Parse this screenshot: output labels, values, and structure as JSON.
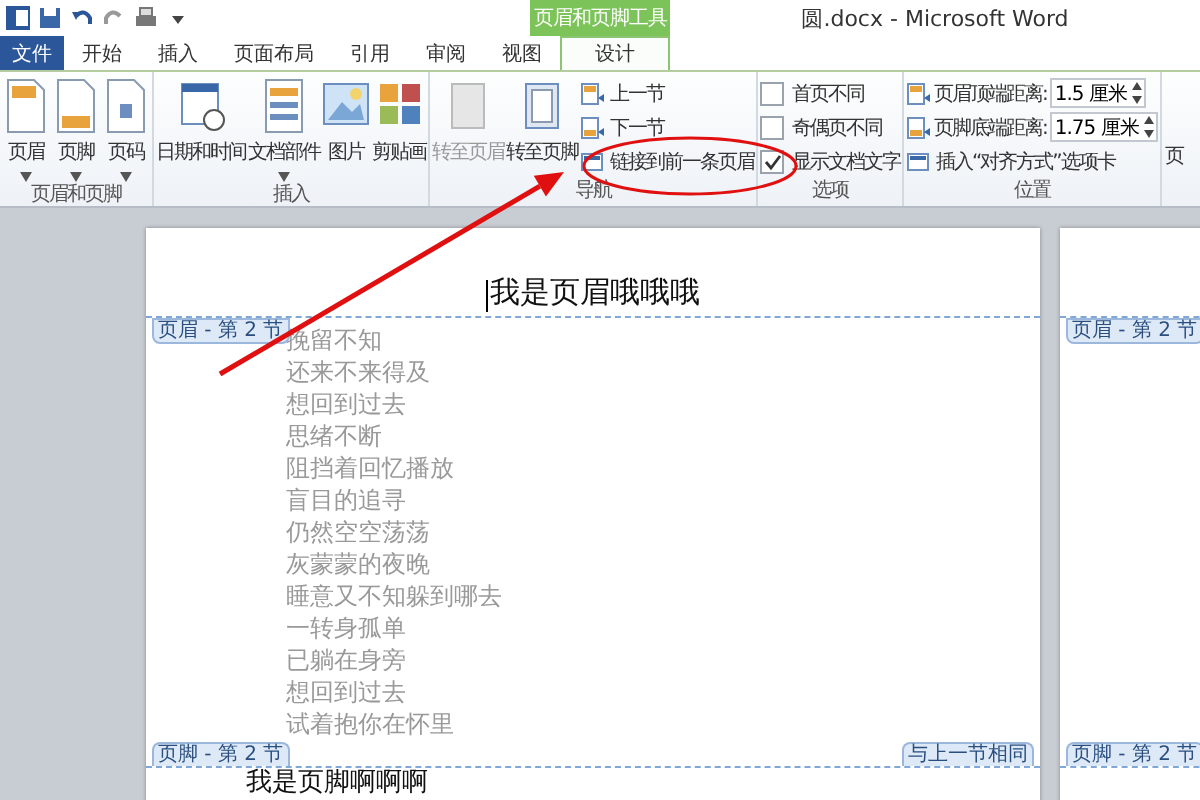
{
  "title_bar": {
    "contextual_tab": "页眉和页脚工具",
    "title": "圆.docx - Microsoft Word"
  },
  "tabs": [
    {
      "label": "文件",
      "kind": "file",
      "selected": false
    },
    {
      "label": "开始",
      "kind": "normal",
      "selected": false
    },
    {
      "label": "插入",
      "kind": "normal",
      "selected": false
    },
    {
      "label": "页面布局",
      "kind": "normal",
      "selected": false
    },
    {
      "label": "引用",
      "kind": "normal",
      "selected": false
    },
    {
      "label": "审阅",
      "kind": "normal",
      "selected": false
    },
    {
      "label": "视图",
      "kind": "normal",
      "selected": false
    },
    {
      "label": "设计",
      "kind": "contextual",
      "selected": true
    }
  ],
  "ribbon_groups": [
    {
      "name": "页眉和页脚",
      "items": [
        {
          "kind": "large",
          "label": "页眉",
          "dropdown": true,
          "disabled": false
        },
        {
          "kind": "large",
          "label": "页脚",
          "dropdown": true,
          "disabled": false
        },
        {
          "kind": "large",
          "label": "页码",
          "dropdown": true,
          "disabled": false
        }
      ]
    },
    {
      "name": "插入",
      "items": [
        {
          "kind": "large",
          "label": "日期和时间",
          "dropdown": false,
          "disabled": false
        },
        {
          "kind": "large",
          "label": "文档部件",
          "dropdown": true,
          "disabled": false
        },
        {
          "kind": "large",
          "label": "图片",
          "dropdown": false,
          "disabled": false
        },
        {
          "kind": "large",
          "label": "剪贴画",
          "dropdown": false,
          "disabled": false
        }
      ]
    },
    {
      "name": "导航",
      "items": [
        {
          "kind": "large",
          "label": "转至页眉",
          "dropdown": false,
          "disabled": true
        },
        {
          "kind": "large",
          "label": "转至页脚",
          "dropdown": false,
          "disabled": false
        },
        {
          "kind": "small",
          "label": "上一节"
        },
        {
          "kind": "small",
          "label": "下一节"
        },
        {
          "kind": "small",
          "label": "链接到前一条页眉"
        }
      ]
    },
    {
      "name": "选项",
      "items": [
        {
          "kind": "checkbox",
          "label": "首页不同",
          "checked": false
        },
        {
          "kind": "checkbox",
          "label": "奇偶页不同",
          "checked": false
        },
        {
          "kind": "checkbox",
          "label": "显示文档文字",
          "checked": true
        }
      ]
    },
    {
      "name": "位置",
      "items": [
        {
          "kind": "spinner",
          "label": "页眉顶端距离:",
          "value": "1.5 厘米"
        },
        {
          "kind": "spinner",
          "label": "页脚底端距离:",
          "value": "1.75 厘米"
        },
        {
          "kind": "small",
          "label": "插入“对齐方式”选项卡"
        }
      ]
    },
    {
      "items": [
        {
          "kind": "cut",
          "label": "页"
        }
      ]
    }
  ],
  "pages": [
    {
      "header_text": "我是页眉哦哦哦",
      "header_tag": "页眉 - 第 2 节",
      "body_lines": [
        "挽留不知",
        "还来不来得及",
        "想回到过去",
        "思绪不断",
        "阻挡着回忆播放",
        "盲目的追寻",
        "仍然空空荡荡",
        "灰蒙蒙的夜晚",
        "睡意又不知躲到哪去",
        "一转身孤单",
        "已躺在身旁",
        "想回到过去",
        "试着抱你在怀里"
      ],
      "footer_tag": "页脚 - 第 2 节",
      "footer_note": "与上一节相同",
      "footer_text": "我是页脚啊啊啊"
    },
    {
      "header_tag": "页眉 - 第 2 节",
      "footer_tag": "页脚 - 第 2 节"
    }
  ],
  "annotations": [
    {
      "kind": "arrow"
    },
    {
      "kind": "ellipse"
    }
  ]
}
